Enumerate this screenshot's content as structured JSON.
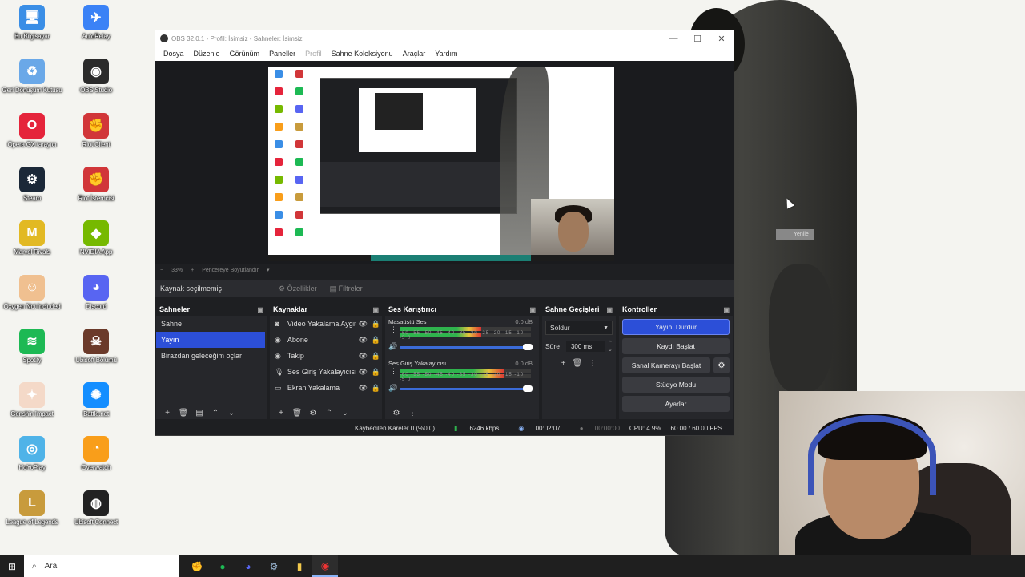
{
  "desktop": {
    "icons": [
      {
        "label": "Bu Bilgisayar",
        "icon": "computer-icon",
        "color": "#3a8ee6",
        "glyph": "🖥"
      },
      {
        "label": "AutoRelay",
        "icon": "autorelay-icon",
        "color": "#3b82f6",
        "glyph": "✈"
      },
      {
        "label": "Geri Dönüşüm Kutusu",
        "icon": "recycle-bin-icon",
        "color": "#6aa8e8",
        "glyph": "♻"
      },
      {
        "label": "OBS Studio",
        "icon": "obs-icon",
        "color": "#2b2b2b",
        "glyph": "◉"
      },
      {
        "label": "Opera GX tarayıcı",
        "icon": "opera-gx-icon",
        "color": "#e5243b",
        "glyph": "O"
      },
      {
        "label": "Riot Client",
        "icon": "riot-client-icon",
        "color": "#d13639",
        "glyph": "✊"
      },
      {
        "label": "Steam",
        "icon": "steam-icon",
        "color": "#1b2838",
        "glyph": "⚙"
      },
      {
        "label": "Riot İstemcisi",
        "icon": "riot-client-icon-2",
        "color": "#d13639",
        "glyph": "✊"
      },
      {
        "label": "Marvel Rivals",
        "icon": "marvel-rivals-icon",
        "color": "#e2b923",
        "glyph": "M"
      },
      {
        "label": "NVIDIA App",
        "icon": "nvidia-icon",
        "color": "#76b900",
        "glyph": "◆"
      },
      {
        "label": "Oxygen Not Included",
        "icon": "oxygen-not-included-icon",
        "color": "#f0c090",
        "glyph": "☺"
      },
      {
        "label": "Discord",
        "icon": "discord-icon",
        "color": "#5865f2",
        "glyph": "◕"
      },
      {
        "label": "Spotify",
        "icon": "spotify-icon",
        "color": "#1db954",
        "glyph": "≋"
      },
      {
        "label": "Ubisoft Bölümü",
        "icon": "ubisoft-game-icon",
        "color": "#6b3a2a",
        "glyph": "☠"
      },
      {
        "label": "Genshin Impact",
        "icon": "genshin-icon",
        "color": "#f4d9c8",
        "glyph": "✦"
      },
      {
        "label": "Battle.net",
        "icon": "battlenet-icon",
        "color": "#148eff",
        "glyph": "✺"
      },
      {
        "label": "HoYoPlay",
        "icon": "hoyoplay-icon",
        "color": "#4fb3e8",
        "glyph": "◎"
      },
      {
        "label": "Overwatch",
        "icon": "overwatch-icon",
        "color": "#f99e1a",
        "glyph": "◔"
      },
      {
        "label": "League of Legends",
        "icon": "league-icon",
        "color": "#c89b3c",
        "glyph": "L"
      },
      {
        "label": "Ubisoft Connect",
        "icon": "ubisoft-connect-icon",
        "color": "#222",
        "glyph": "◍"
      }
    ]
  },
  "obs": {
    "title": "OBS 32.0.1 - Profil: İsimsiz - Sahneler: İsimsiz",
    "window_controls": [
      "—",
      "☐",
      "✕"
    ],
    "menu": [
      "Dosya",
      "Düzenle",
      "Görünüm",
      "Paneller",
      "Profil",
      "Sahne Koleksiyonu",
      "Araçlar",
      "Yardım"
    ],
    "zoom": {
      "minus": "−",
      "value": "33%",
      "plus": "+",
      "fit_label": "Pencereye Boyutlandır"
    },
    "source_toolbar": {
      "no_selection": "Kaynak seçilmemiş",
      "properties": "Özellikler",
      "filters": "Filtreler"
    },
    "scenes": {
      "header": "Sahneler",
      "items": [
        "Sahne",
        "Yayın",
        "Birazdan geleceğim oçlar"
      ],
      "active_index": 1
    },
    "sources": {
      "header": "Kaynaklar",
      "items": [
        {
          "name": "Video Yakalama Aygıtı",
          "icon": "camera-icon",
          "glyph": "◙"
        },
        {
          "name": "Abone",
          "icon": "image-source-icon",
          "glyph": "◉"
        },
        {
          "name": "Takip",
          "icon": "image-source-icon",
          "glyph": "◉"
        },
        {
          "name": "Ses Giriş Yakalayıcısı",
          "icon": "microphone-icon",
          "glyph": "🎙"
        },
        {
          "name": "Ekran Yakalama",
          "icon": "monitor-icon",
          "glyph": "▭"
        }
      ]
    },
    "mixer": {
      "header": "Ses Karıştırıcı",
      "channels": [
        {
          "name": "Masaüstü Ses",
          "db": "0.0 dB",
          "level": 0.62
        },
        {
          "name": "Ses Giriş Yakalayıcısı",
          "db": "0.0 dB",
          "level": 0.8
        }
      ],
      "scale": "-60 -55 -50 -45 -40 -35 -30 -25 -20 -15 -10 -5 0"
    },
    "transitions": {
      "header": "Sahne Geçişleri",
      "selected": "Soldur",
      "duration_label": "Süre",
      "duration_value": "300 ms"
    },
    "controls": {
      "header": "Kontroller",
      "stop_stream": "Yayını Durdur",
      "start_recording": "Kaydı Başlat",
      "start_virtualcam": "Sanal Kamerayı Başlat",
      "studio_mode": "Stüdyo Modu",
      "settings": "Ayarlar"
    },
    "status": {
      "dropped_frames": "Kaybedilen Kareler 0 (%0.0)",
      "bitrate": "6246 kbps",
      "stream_time": "00:02:07",
      "rec_time": "00:00:00",
      "cpu": "CPU: 4.9%",
      "fps": "60.00 / 60.00 FPS"
    }
  },
  "tooltip": "Yenile",
  "taskbar": {
    "search_placeholder": "Ara",
    "apps": [
      {
        "icon": "riot-taskbar-icon",
        "glyph": "✊",
        "color": "#e33"
      },
      {
        "icon": "spotify-taskbar-icon",
        "glyph": "●",
        "color": "#1db954"
      },
      {
        "icon": "discord-taskbar-icon",
        "glyph": "◕",
        "color": "#5865f2"
      },
      {
        "icon": "steam-taskbar-icon",
        "glyph": "⚙",
        "color": "#9fbcd9"
      },
      {
        "icon": "file-explorer-icon",
        "glyph": "▮",
        "color": "#f2c94c"
      },
      {
        "icon": "obs-taskbar-icon",
        "glyph": "◉",
        "color": "#e33"
      }
    ]
  }
}
